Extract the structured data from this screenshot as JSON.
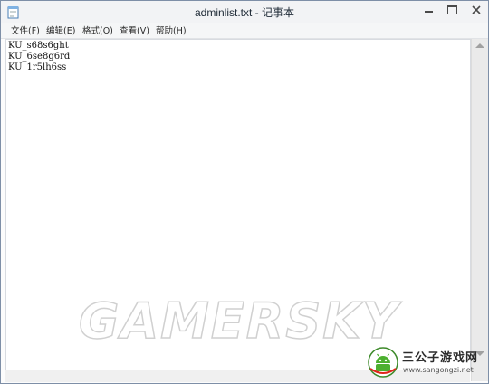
{
  "window": {
    "title": "adminlist.txt - 记事本"
  },
  "menu": {
    "items": [
      {
        "label": "文件(F)"
      },
      {
        "label": "编辑(E)"
      },
      {
        "label": "格式(O)"
      },
      {
        "label": "查看(V)"
      },
      {
        "label": "帮助(H)"
      }
    ]
  },
  "editor": {
    "lines": [
      "KU_s68s6ght",
      "KU_6se8g6rd",
      "KU_1r5lh6ss"
    ]
  },
  "watermark": {
    "text": "GAMERSKY"
  },
  "brand": {
    "name": "三公子游戏网",
    "url": "www.sangongzi.net"
  },
  "icons": {
    "app": "notepad-icon",
    "minimize": "minimize-icon",
    "maximize": "maximize-icon",
    "close": "close-icon",
    "brand": "android-robot-icon"
  }
}
